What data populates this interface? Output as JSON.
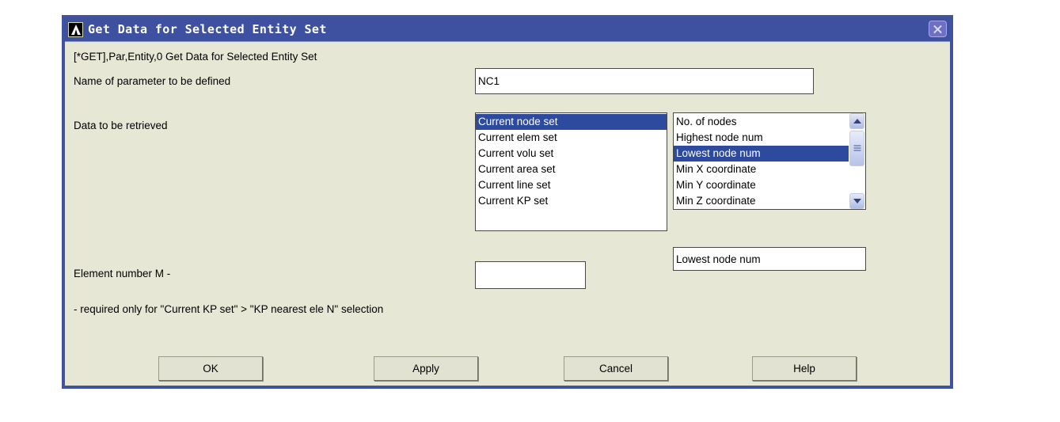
{
  "window": {
    "title": "Get Data for Selected Entity Set",
    "icon": "ansys-logo-icon",
    "close_label": "close-icon",
    "titlebar_color": "#3d51a0",
    "background_color": "#e7e7d5"
  },
  "dialog": {
    "subtitle": "[*GET],Par,Entity,0  Get Data for Selected Entity Set",
    "label_parameter": "Name of parameter to be defined",
    "label_data": "Data to be retrieved",
    "label_element_number": "Element number M -",
    "note": "- required only for \"Current KP set\" > \"KP nearest ele N\" selection"
  },
  "fields": {
    "parameter_name": {
      "value": "NC1",
      "placeholder": ""
    },
    "selected_item": {
      "value": "Lowest node num",
      "placeholder": ""
    },
    "element_number": {
      "value": "",
      "placeholder": ""
    }
  },
  "entity_list": {
    "items": [
      "Current node set",
      "Current elem set",
      "Current volu set",
      "Current area set",
      "Current line set",
      "Current KP set"
    ],
    "selected_index": 0,
    "selection_color": "#2e4a9e"
  },
  "data_list": {
    "items": [
      "No. of nodes",
      "Highest node num",
      "Lowest node num",
      "Min X coordinate",
      "Min Y coordinate",
      "Min Z coordinate"
    ],
    "selected_index": 2,
    "selection_color": "#2e4a9e",
    "scrollbar": {
      "up_icon": "chevron-up-icon",
      "down_icon": "chevron-down-icon",
      "thumb": "scrollbar-thumb"
    }
  },
  "buttons": {
    "ok": "OK",
    "apply": "Apply",
    "cancel": "Cancel",
    "help": "Help"
  }
}
